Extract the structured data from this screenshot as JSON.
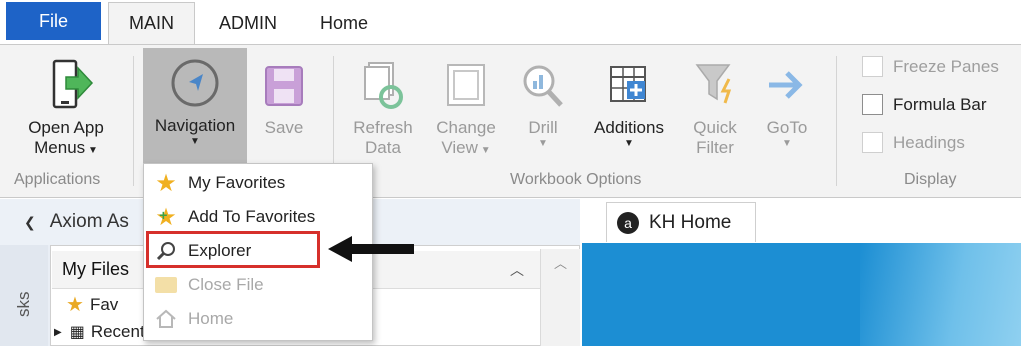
{
  "tabs": {
    "file": "File",
    "main": "MAIN",
    "admin": "ADMIN",
    "home": "Home"
  },
  "ribbon": {
    "open_app_menus": {
      "line1": "Open App",
      "line2": "Menus"
    },
    "navigation": "Navigation",
    "save": "Save",
    "refresh_data": {
      "line1": "Refresh",
      "line2": "Data"
    },
    "change_view": {
      "line1": "Change",
      "line2": "View"
    },
    "drill": "Drill",
    "additions": "Additions",
    "quick_filter": {
      "line1": "Quick",
      "line2": "Filter"
    },
    "goto": "GoTo",
    "freeze_panes": "Freeze Panes",
    "formula_bar": "Formula Bar",
    "headings": "Headings",
    "groups": {
      "applications": "Applications",
      "workbook_options": "Workbook Options",
      "display": "Display"
    }
  },
  "menu": {
    "items": [
      {
        "label": "My Favorites",
        "enabled": true
      },
      {
        "label": "Add To Favorites",
        "enabled": true
      },
      {
        "label": "Explorer",
        "enabled": true
      },
      {
        "label": "Close File",
        "enabled": false
      },
      {
        "label": "Home",
        "enabled": false
      }
    ]
  },
  "pane": {
    "title": "Axiom As",
    "my_files": "My Files",
    "tree": [
      "Fav",
      "Recent"
    ],
    "vertical_tab": "sks"
  },
  "document_tab": {
    "label": "KH Home"
  },
  "colors": {
    "file_tab": "#1e63c7",
    "highlight": "#d6302b",
    "doc_blue": "#1c8ed3"
  }
}
